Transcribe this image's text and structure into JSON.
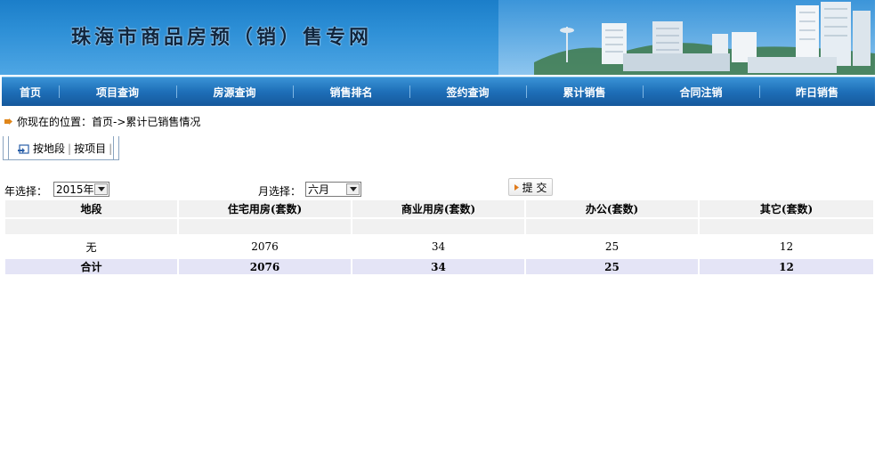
{
  "banner": {
    "title": "珠海市商品房预（销）售专网"
  },
  "nav": [
    {
      "label": "首页"
    },
    {
      "label": "项目查询"
    },
    {
      "label": "房源查询"
    },
    {
      "label": "销售排名"
    },
    {
      "label": "签约查询"
    },
    {
      "label": "累计销售"
    },
    {
      "label": "合同注销"
    },
    {
      "label": "昨日销售"
    }
  ],
  "breadcrumb": {
    "prefix": "你现在的位置：",
    "home": "首页",
    "current": " ->累计已销售情况"
  },
  "subtabs": {
    "by_district": "按地段",
    "separator": "|",
    "by_project": "按项目"
  },
  "filters": {
    "year_label": "年选择：",
    "year_value": "2015年",
    "month_label": "月选择：",
    "month_value": "六月",
    "submit_label": "提 交"
  },
  "table": {
    "headers": [
      "地段",
      "住宅用房(套数)",
      "商业用房(套数)",
      "办公(套数)",
      "其它(套数)"
    ],
    "rows": [
      [
        "无",
        "2076",
        "34",
        "25",
        "12"
      ]
    ],
    "total": [
      "合计",
      "2076",
      "34",
      "25",
      "12"
    ]
  },
  "colors": {
    "banner_blue": "#1b7ec9",
    "nav_blue": "#1e6fb8",
    "total_row_bg": "#e4e4f6",
    "header_bg": "#f1f1f1"
  }
}
